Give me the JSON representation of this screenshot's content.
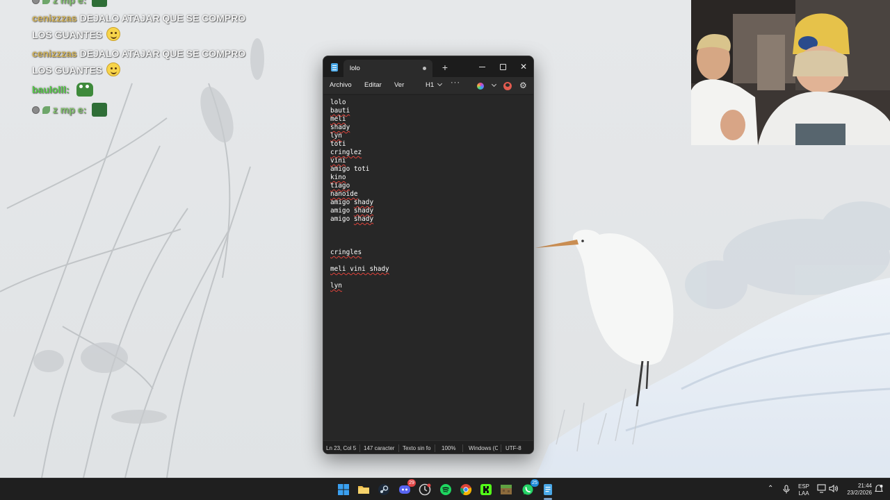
{
  "chat": {
    "messages": [
      {
        "user": "",
        "text": "",
        "kind": "badges-partial"
      },
      {
        "user": "cenizzzas",
        "line1": "DEJALO ATAJAR QUE SE COMPRO",
        "line2": "LOS GUANTES"
      },
      {
        "user": "cenizzzas",
        "line1": "DEJALO ATAJAR QUE SE COMPRO",
        "line2": "LOS GUANTES"
      },
      {
        "user": "baulolll:",
        "line1": "",
        "line2": ""
      },
      {
        "user": "z   mp   e:",
        "line1": "",
        "line2": ""
      }
    ],
    "colors": {
      "user_cenizzzas": "#d3b45a",
      "user_baulolll": "#58c94a",
      "user_zample": "#7fbf6a"
    }
  },
  "notepad": {
    "tab_title": "lolo",
    "menu": {
      "file": "Archivo",
      "edit": "Editar",
      "view": "Ver",
      "heading": "H1",
      "more": "···"
    },
    "lines": [
      {
        "text": "lolo",
        "squiggle": false
      },
      {
        "text": "bauti",
        "squiggle": true
      },
      {
        "text": "meli",
        "squiggle": true
      },
      {
        "text": "shady",
        "squiggle": true
      },
      {
        "text": "lyn",
        "squiggle": true
      },
      {
        "text": "toti",
        "squiggle": false
      },
      {
        "text": "cringlez",
        "squiggle": true
      },
      {
        "text": "vini",
        "squiggle": true
      },
      {
        "text": "amigo toti",
        "squiggle": false
      },
      {
        "text": "kino",
        "squiggle": true
      },
      {
        "text": "tiago",
        "squiggle": true
      },
      {
        "text": "nanoide",
        "squiggle": true
      },
      {
        "text": "amigo shady",
        "squiggle": "partial"
      },
      {
        "text": "amigo shady",
        "squiggle": "partial"
      },
      {
        "text": "amigo shady",
        "squiggle": "partial"
      },
      {
        "text": "",
        "squiggle": false
      },
      {
        "text": "",
        "squiggle": false
      },
      {
        "text": "",
        "squiggle": false
      },
      {
        "text": "cringles",
        "squiggle": true
      },
      {
        "text": "",
        "squiggle": false
      },
      {
        "text": "meli vini shady",
        "squiggle": true
      },
      {
        "text": "",
        "squiggle": false
      },
      {
        "text": "lyn",
        "squiggle": true
      }
    ],
    "status": {
      "position": "Ln 23, Col 5",
      "chars": "147 caracter",
      "format": "Texto sin fo",
      "zoom": "100%",
      "line_ending": "Windows (C",
      "encoding": "UTF-8"
    }
  },
  "taskbar": {
    "apps": [
      {
        "name": "start",
        "color": "#3aa0f0"
      },
      {
        "name": "file-explorer",
        "color": "#f2c14e"
      },
      {
        "name": "steam",
        "color": "#c7d5e0"
      },
      {
        "name": "discord",
        "color": "#5865f2",
        "badge": "29"
      },
      {
        "name": "clock-app",
        "color": "#cfcfcf"
      },
      {
        "name": "spotify",
        "color": "#1ed760"
      },
      {
        "name": "chrome",
        "color": "#f2b21b"
      },
      {
        "name": "kick",
        "color": "#53fc18"
      },
      {
        "name": "minecraft",
        "color": "#8c6b3c"
      },
      {
        "name": "whatsapp",
        "color": "#25d366",
        "badge": "25"
      },
      {
        "name": "notepad",
        "color": "#4aa8e8"
      }
    ],
    "tray": {
      "lang_top": "ESP",
      "lang_bottom": "LAA",
      "time": "21:44",
      "date": "23/2/2026"
    }
  }
}
